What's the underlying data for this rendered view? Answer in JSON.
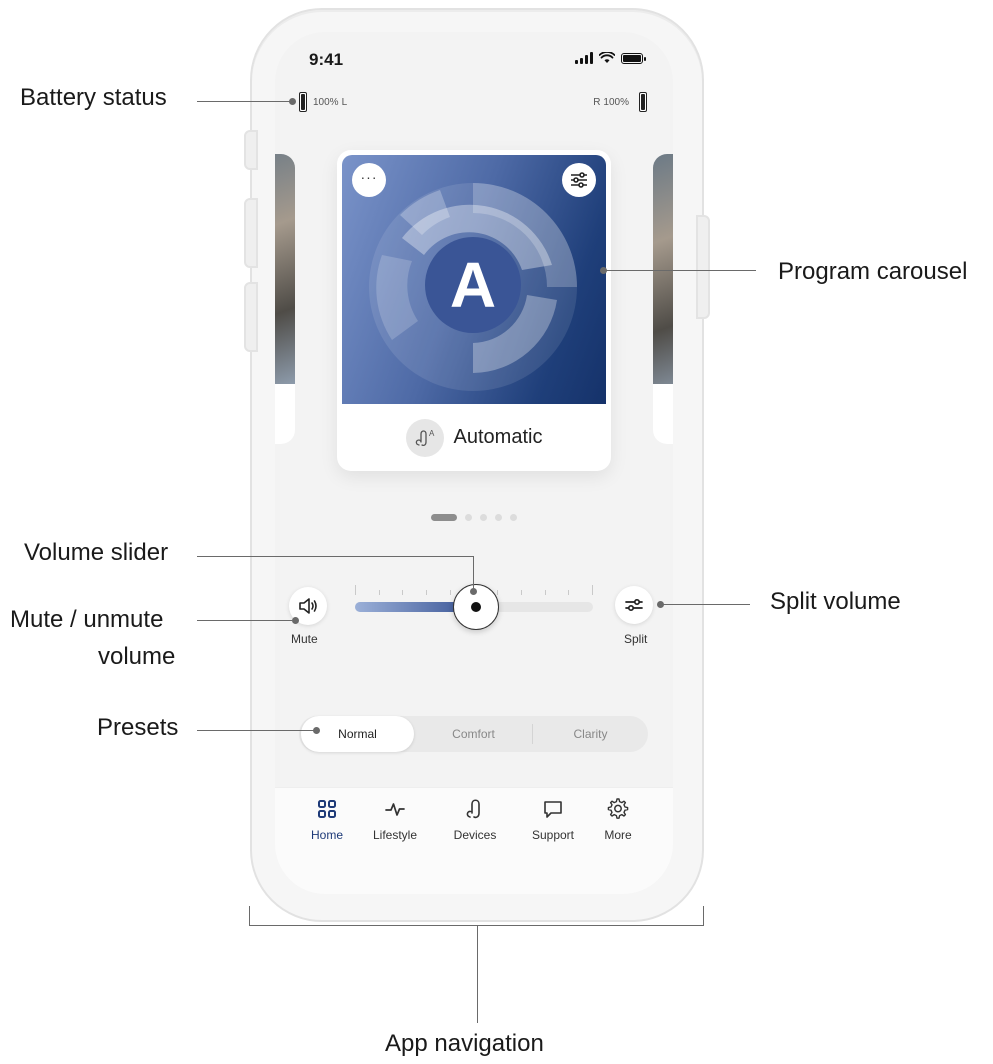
{
  "status_bar": {
    "time": "9:41"
  },
  "hearing_aids": {
    "left": {
      "percent": "100%",
      "side": "L"
    },
    "right": {
      "percent": "100%",
      "side": "R"
    }
  },
  "program": {
    "name": "Automatic",
    "letter": "A",
    "more_icon": "more-icon",
    "settings_icon": "sliders-icon",
    "pages": 5,
    "active_page": 1
  },
  "volume": {
    "mute_label": "Mute",
    "split_label": "Split",
    "level": 0.5
  },
  "presets": {
    "items": [
      "Normal",
      "Comfort",
      "Clarity"
    ],
    "selected": "Normal"
  },
  "tabs": [
    {
      "label": "Home",
      "icon": "grid-icon",
      "active": true
    },
    {
      "label": "Lifestyle",
      "icon": "activity-icon",
      "active": false
    },
    {
      "label": "Devices",
      "icon": "hearing-aid-icon",
      "active": false
    },
    {
      "label": "Support",
      "icon": "chat-icon",
      "active": false
    },
    {
      "label": "More",
      "icon": "gear-icon",
      "active": false
    }
  ],
  "callouts": {
    "battery_status": "Battery status",
    "program_carousel": "Program carousel",
    "volume_slider": "Volume slider",
    "split_volume": "Split volume",
    "mute_unmute_line1": "Mute / unmute",
    "mute_unmute_line2": "volume",
    "presets": "Presets",
    "app_navigation": "App navigation"
  },
  "colors": {
    "accent": "#1e3a78",
    "card_gradient_start": "#7a93c9",
    "card_gradient_end": "#15326a"
  }
}
